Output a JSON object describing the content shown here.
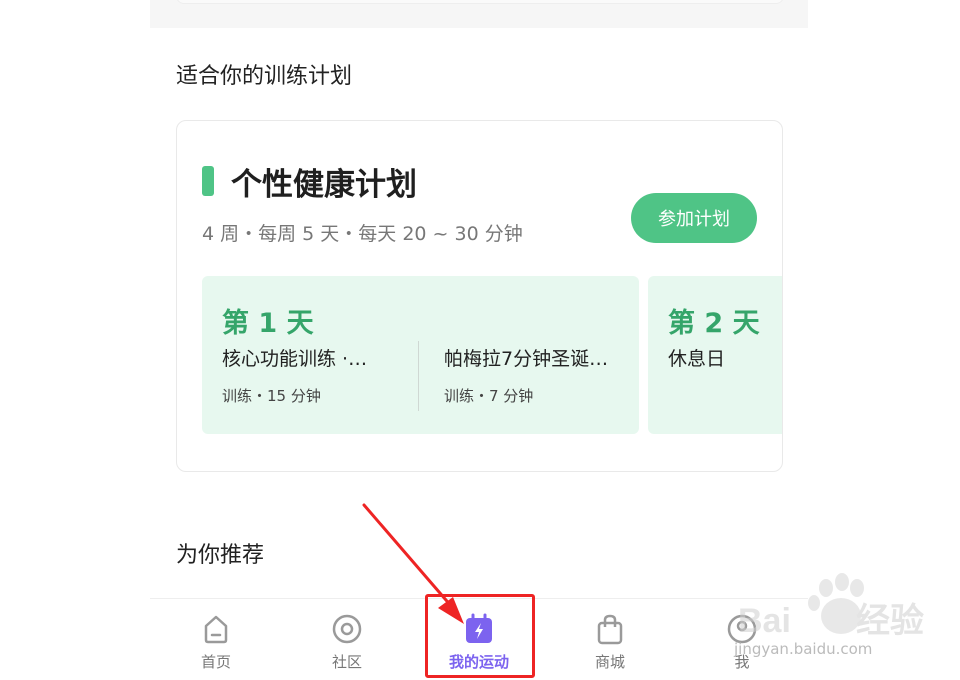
{
  "section_title": "适合你的训练计划",
  "plan": {
    "name": "个性健康计划",
    "meta": "4 周・每周 5 天・每天 20 ~ 30 分钟",
    "join_button": "参加计划",
    "days": [
      {
        "title": "第 1 天",
        "workouts": [
          {
            "name": "核心功能训练 ·…",
            "meta": "训练・15 分钟"
          },
          {
            "name": "帕梅拉7分钟圣诞…",
            "meta": "训练・7 分钟"
          }
        ]
      },
      {
        "title": "第 2 天",
        "rest": "休息日"
      }
    ]
  },
  "recommend_title": "为你推荐",
  "tabbar": {
    "tabs": [
      {
        "label": "首页",
        "icon": "home-icon"
      },
      {
        "label": "社区",
        "icon": "community-icon"
      },
      {
        "label": "我的运动",
        "icon": "workout-icon",
        "active": true
      },
      {
        "label": "商城",
        "icon": "shop-bag-icon"
      },
      {
        "label": "我",
        "icon": "profile-icon"
      }
    ]
  },
  "watermark": {
    "brand": "Baidu经验",
    "url": "jingyan.baidu.com"
  },
  "colors": {
    "accent_green": "#4fc486",
    "day_bg": "#e7f8ef",
    "day_title": "#35a56a",
    "active_tab": "#7c63ef",
    "annotation_red": "#ee2424"
  }
}
